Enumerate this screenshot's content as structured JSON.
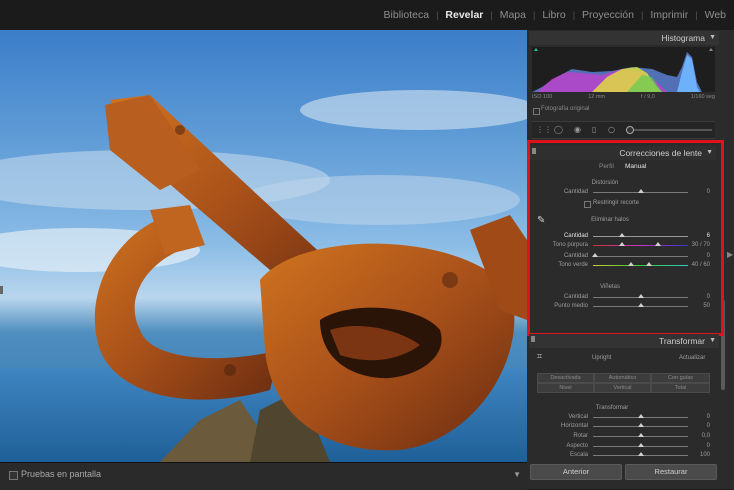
{
  "modules": [
    "Biblioteca",
    "Revelar",
    "Mapa",
    "Libro",
    "Proyección",
    "Imprimir",
    "Web"
  ],
  "active_module": "Revelar",
  "histogram": {
    "title": "Histograma",
    "iso": "ISO 100",
    "focal": "12 mm",
    "aperture": "f / 9,0",
    "shutter": "1/160 seg",
    "original_photo_label": "Fotografía original"
  },
  "lens": {
    "title": "Correcciones de lente",
    "tabs": [
      "Perfil",
      "Manual"
    ],
    "active_tab": "Manual",
    "distortion": {
      "heading": "Distorsión",
      "amount_label": "Cantidad",
      "amount_value": "0",
      "amount_level": 0.5,
      "constrain_crop_label": "Restringir recorte"
    },
    "defringe": {
      "heading": "Eliminar halos",
      "amount_purple_label": "Cantidad",
      "amount_purple_value": "6",
      "amount_purple_level": 0.3,
      "hue_purple_label": "Tono púrpura",
      "hue_purple_value": "30 / 70",
      "amount_green_label": "Cantidad",
      "amount_green_value": "0",
      "amount_green_level": 0.0,
      "hue_green_label": "Tono verde",
      "hue_green_value": "40 / 60"
    },
    "vignetting": {
      "heading": "Viñetas",
      "amount_label": "Cantidad",
      "amount_value": "0",
      "amount_level": 0.5,
      "midpoint_label": "Punto medio",
      "midpoint_value": "50",
      "midpoint_level": 0.5
    }
  },
  "transform": {
    "title": "Transformar",
    "upright_label": "Upright",
    "update_label": "Actualizar",
    "buttons_row1": [
      "Desactivada",
      "Automático",
      "Con guías"
    ],
    "buttons_row2": [
      "Nivel",
      "Vertical",
      "Total"
    ],
    "section_label": "Transformar",
    "sliders": [
      {
        "label": "Vertical",
        "value": "0",
        "level": 0.5
      },
      {
        "label": "Horizontal",
        "value": "0",
        "level": 0.5
      },
      {
        "label": "Rotar",
        "value": "0,0",
        "level": 0.5
      },
      {
        "label": "Aspecto",
        "value": "0",
        "level": 0.5
      },
      {
        "label": "Escala",
        "value": "100",
        "level": 0.5
      }
    ]
  },
  "toolbar": {
    "preview_label": "Pruebas en pantalla"
  },
  "footer": {
    "previous_label": "Anterior",
    "reset_label": "Restaurar"
  }
}
